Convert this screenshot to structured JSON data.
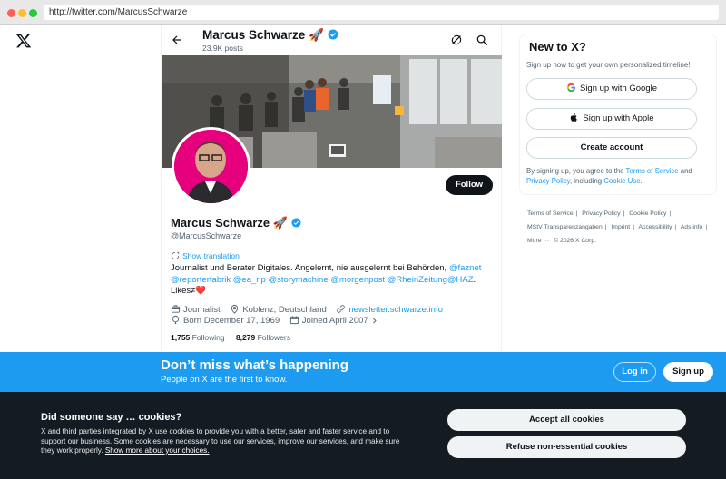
{
  "browser": {
    "url": "http://twitter.com/MarcusSchwarze"
  },
  "header": {
    "name": "Marcus Schwarze",
    "name_emoji": "🚀",
    "posts": "23.9K posts"
  },
  "profile": {
    "name": "Marcus Schwarze",
    "name_emoji": "🚀",
    "handle": "@MarcusSchwarze",
    "follow_label": "Follow",
    "translate_label": "Show translation",
    "bio_text": "Journalist und Berater Digitales. Angelernt, nie ausgelernt bei Behörden, ",
    "bio_links": [
      "@faznet",
      "@reporterfabrik",
      "@ea_rlp",
      "@storymachine",
      "@morgenpost",
      "@RheinZeitung",
      "@HAZ"
    ],
    "bio_suffix": "Likes≠",
    "bio_heart": "❤️",
    "category": "Journalist",
    "location": "Koblenz, Deutschland",
    "website": "newsletter.schwarze.info",
    "born": "Born December 17, 1969",
    "joined": "Joined April 2007",
    "following_count": "1,755",
    "following_label": "Following",
    "followers_count": "8,279",
    "followers_label": "Followers"
  },
  "sidebar": {
    "title": "New to X?",
    "subtitle": "Sign up now to get your own personalized timeline!",
    "google_label": "Sign up with Google",
    "apple_label": "Sign up with Apple",
    "create_label": "Create account",
    "terms_prefix": "By signing up, you agree to the ",
    "terms_link": "Terms of Service",
    "terms_and": " and ",
    "privacy_link": "Privacy Policy",
    "terms_including": ", including ",
    "cookie_link": "Cookie Use",
    "terms_end": "."
  },
  "footer": {
    "links": [
      "Terms of Service",
      "Privacy Policy",
      "Cookie Policy",
      "MStV Transparenzangaben",
      "Imprint",
      "Accessibility",
      "Ads info",
      "More ···",
      "© 2026 X Corp."
    ]
  },
  "signup_bar": {
    "title": "Don’t miss what’s happening",
    "subtitle": "People on X are the first to know.",
    "login_label": "Log in",
    "signup_label": "Sign up"
  },
  "cookie_banner": {
    "title": "Did someone say … cookies?",
    "text": "X and third parties integrated by X use cookies to provide you with a better, safer and faster service and to support our business. Some cookies are necessary to use our services, improve our services, and make sure they work properly. ",
    "more_link": "Show more about your choices.",
    "accept_label": "Accept all cookies",
    "refuse_label": "Refuse non-essential cookies"
  },
  "colors": {
    "accent": "#1d9bf0",
    "cookie_bg": "#151b22",
    "avatar_bg": "#e6007e"
  }
}
